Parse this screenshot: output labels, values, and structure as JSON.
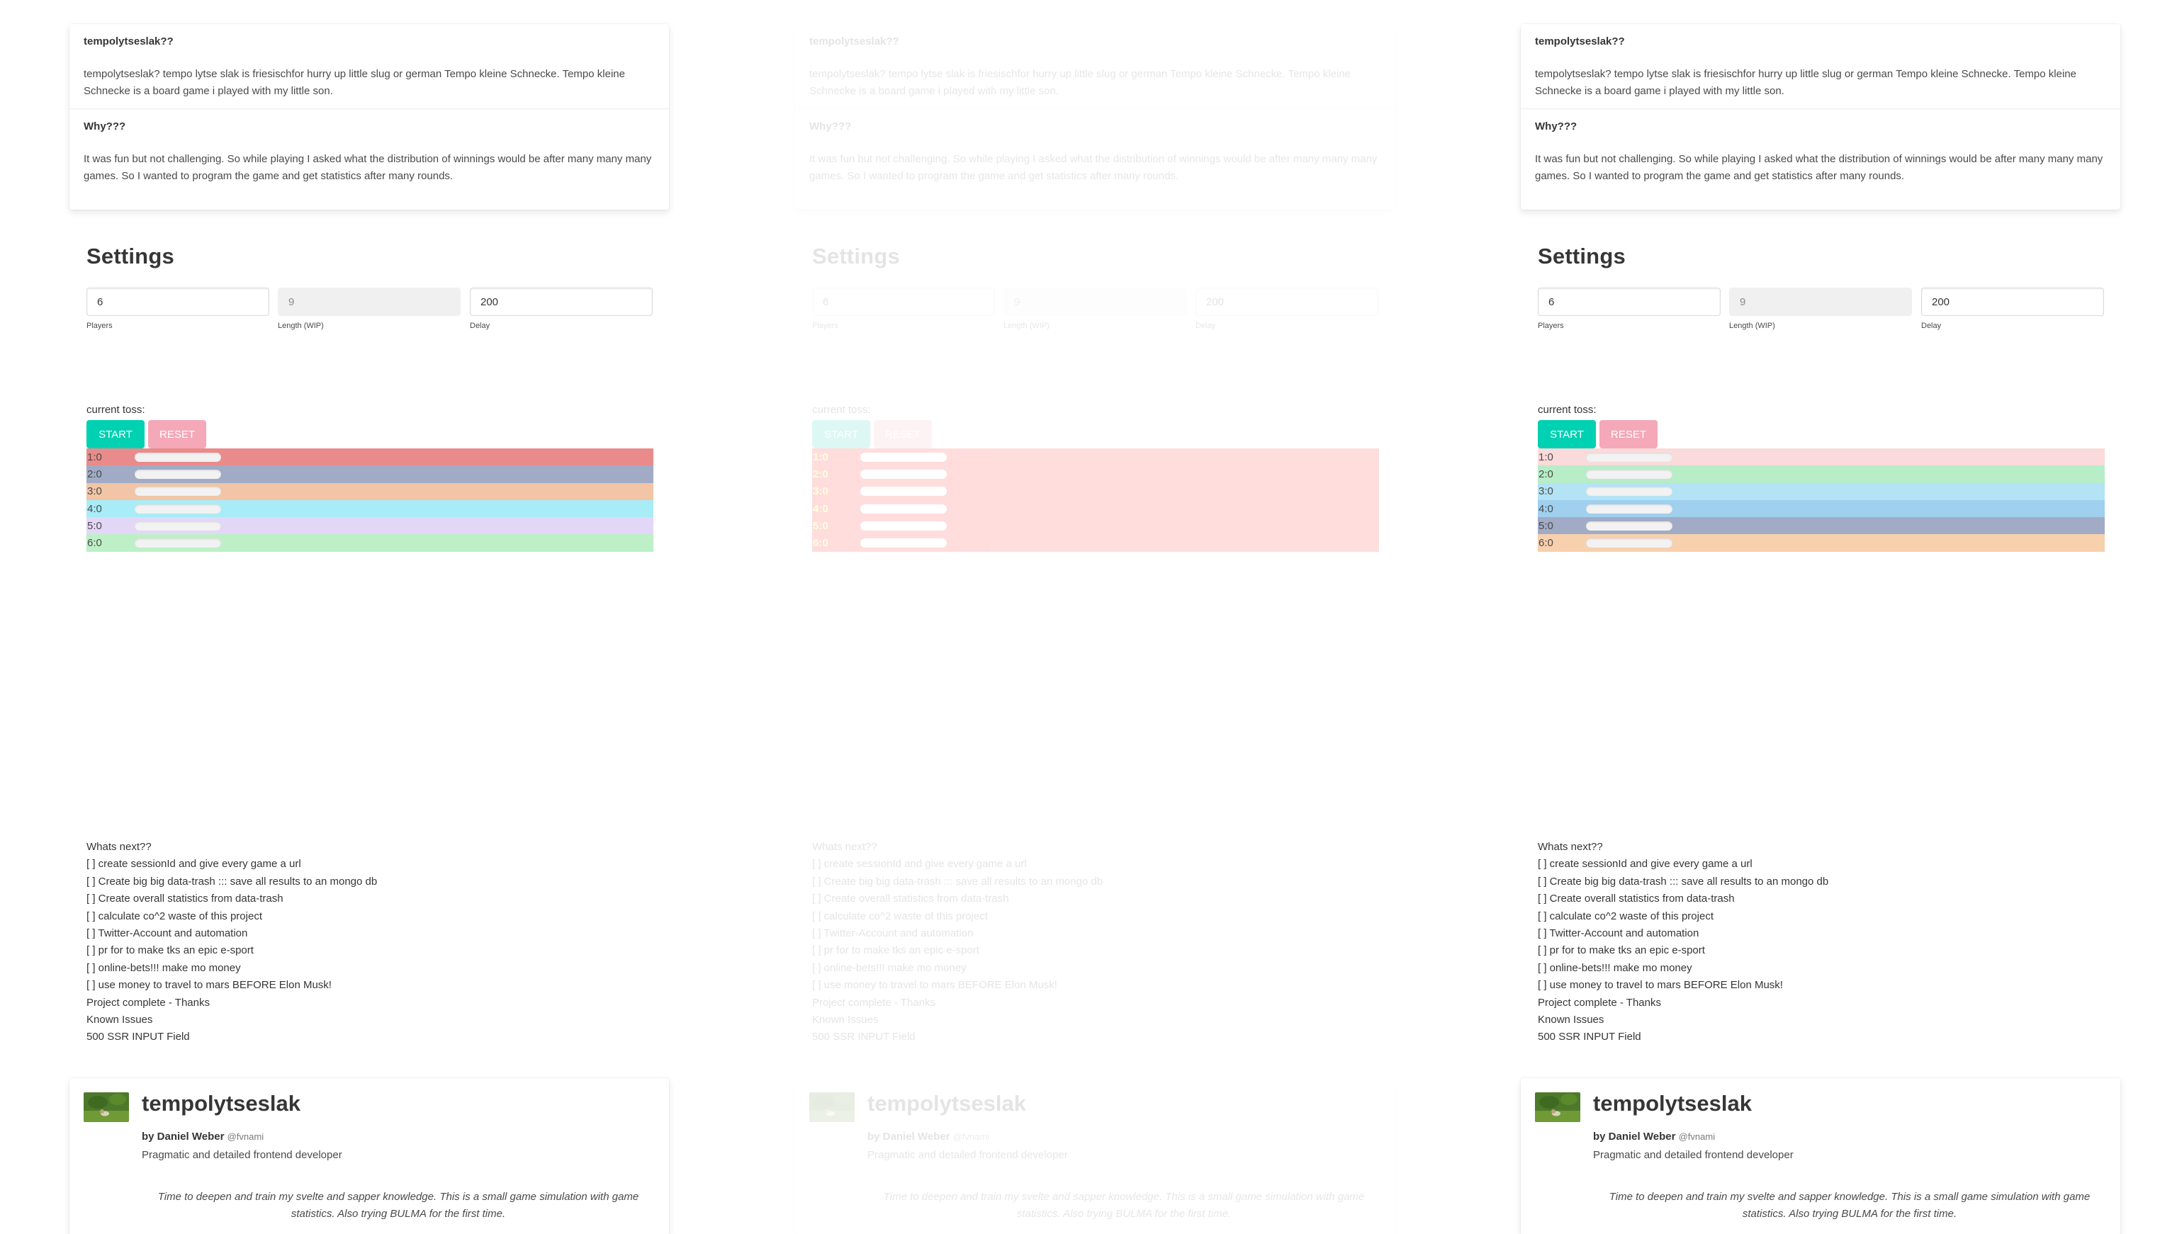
{
  "info": {
    "title1": "tempolytseslak??",
    "text1": "tempolytseslak? tempo lytse slak is friesischfor hurry up little slug or german Tempo kleine Schnecke. Tempo kleine Schnecke is a board game i played with my little son.",
    "title2": "Why???",
    "text2": "It was fun but not challenging. So while playing I asked what the distribution of winnings would be after many many many games. So I wanted to program the game and get statistics after many rounds."
  },
  "settings": {
    "title": "Settings",
    "players_value": "6",
    "players_label": "Players",
    "length_value": "9",
    "length_label": "Length (WIP)",
    "delay_value": "200",
    "delay_label": "Delay"
  },
  "game": {
    "current_toss_label": "current toss:",
    "start_label": "START",
    "reset_label": "RESET",
    "lanes": [
      "1:0",
      "2:0",
      "3:0",
      "4:0",
      "5:0",
      "6:0"
    ],
    "lane_colors_left": [
      "#ea8b8b",
      "#a1abc6",
      "#f1c5a5",
      "#a8ecf7",
      "#e3d7f7",
      "#bdf0c6"
    ],
    "lane_colors_right": [
      "#fadada",
      "#b7edc7",
      "#b3e3f5",
      "#9fd0ee",
      "#a1abc6",
      "#f7d0ad"
    ],
    "lane_color_middle": "#ff0000"
  },
  "todo": {
    "heading": "Whats next??",
    "items": [
      "[ ] create sessionId and give every game a url",
      "[ ] Create big big data-trash ::: save all results to an mongo db",
      "[ ] Create overall statistics from data-trash",
      "[ ] calculate co^2 waste of this project",
      "[ ] Twitter-Account and automation",
      "[ ] pr for to make tks an epic e-sport",
      "[ ] online-bets!!! make mo money",
      "[ ] use money to travel to mars BEFORE Elon Musk!"
    ],
    "complete": "Project complete - Thanks",
    "known_issues": "Known Issues",
    "issue1": "500 SSR INPUT Field"
  },
  "profile": {
    "title": "tempolytseslak",
    "by": "by Daniel Weber",
    "handle": "@fvnami",
    "role": "Pragmatic and detailed frontend developer",
    "description": "Time to deepen and train my svelte and sapper knowledge. This is a small game simulation with game statistics. Also trying BULMA for the first time."
  }
}
